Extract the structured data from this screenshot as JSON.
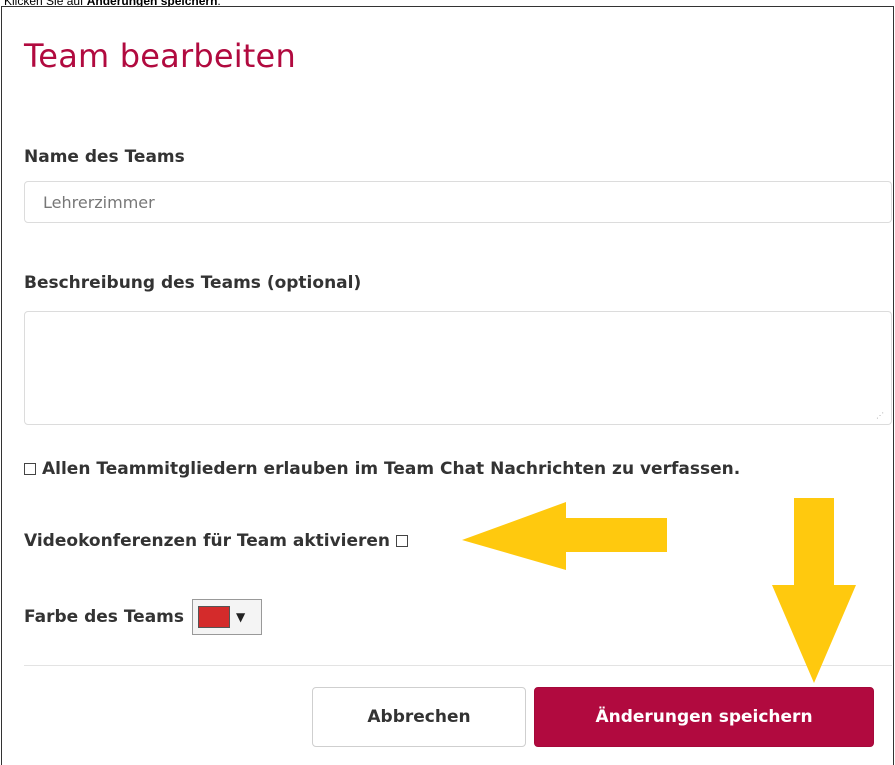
{
  "caption": {
    "prefix": "Klicken Sie auf ",
    "bold": "Änderungen speichern",
    "suffix": "."
  },
  "dialog": {
    "title": "Team bearbeiten",
    "name_label": "Name des Teams",
    "name_value": "Lehrerzimmer",
    "description_label": "Beschreibung des Teams (optional)",
    "description_value": "",
    "chat_permission_label": "Allen Teammitgliedern erlauben im Team Chat Nachrichten zu verfassen.",
    "chat_permission_checked": false,
    "video_label": "Videokonferenzen für Team aktivieren",
    "video_checked": false,
    "color_label": "Farbe des Teams",
    "color_value": "#d42b2b",
    "cancel_label": "Abbrechen",
    "save_label": "Änderungen speichern"
  },
  "colors": {
    "accent": "#b10a3f",
    "annotation_arrow": "#ffc90e"
  }
}
